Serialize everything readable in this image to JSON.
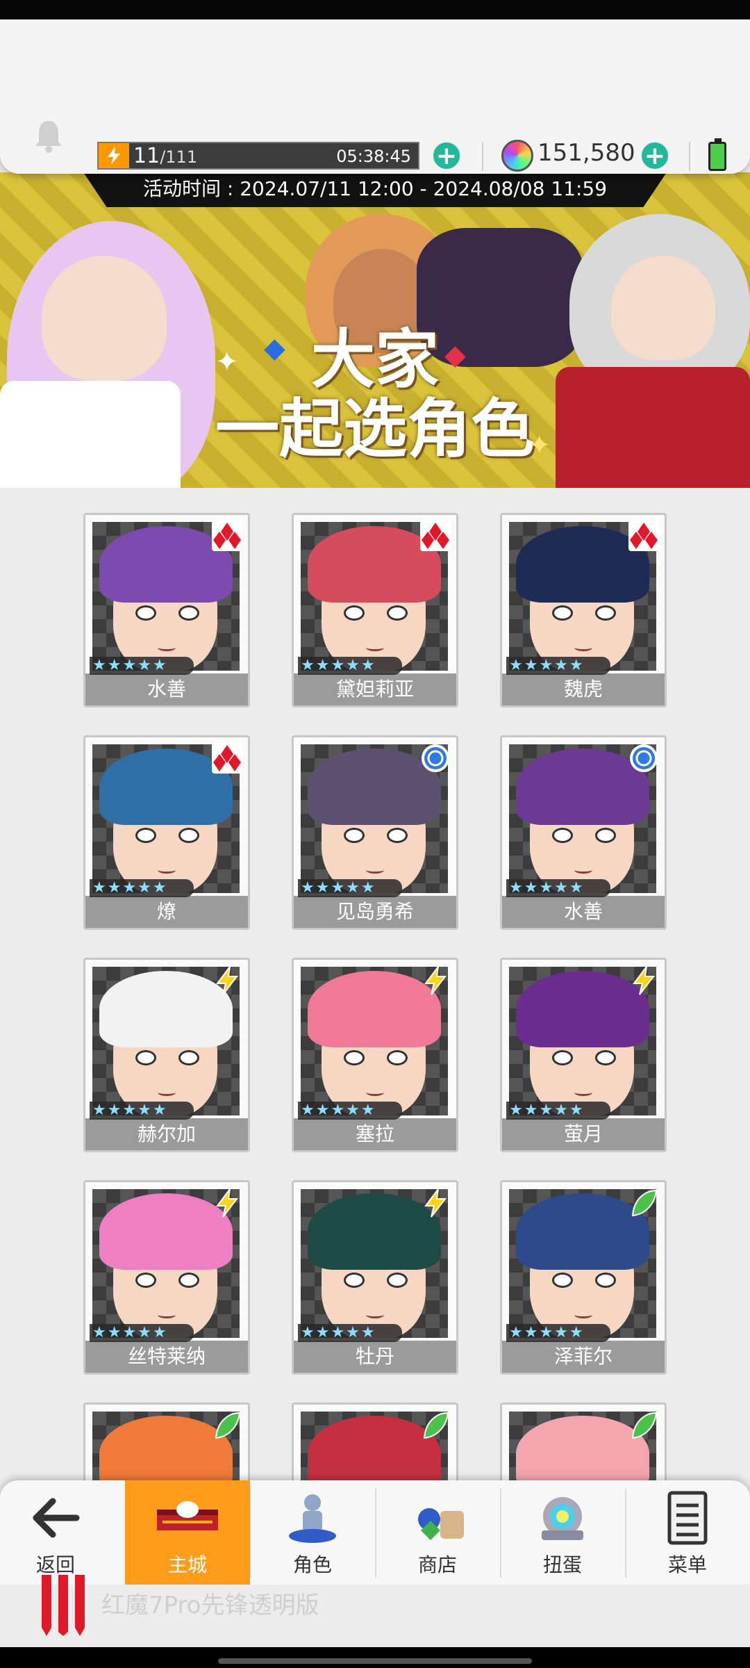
{
  "header": {
    "energy_current": "11",
    "energy_max": "/111",
    "energy_timer": "05:38:45",
    "energy_add": "+",
    "gems": "151,580",
    "gems_add": "+"
  },
  "banner": {
    "time": "活动时间 : 2024.07/11 12:00 - 2024.08/08 11:59",
    "title_line1": "大家",
    "title_line2": "一起选角色"
  },
  "characters": [
    {
      "name": "水善",
      "badge": "diamond",
      "stars": "★★★★★",
      "hair": "#7b4bb0"
    },
    {
      "name": "黛妲莉亚",
      "badge": "diamond",
      "stars": "★★★★★",
      "hair": "#d84a5e"
    },
    {
      "name": "魏虎",
      "badge": "diamond",
      "stars": "★★★★★",
      "hair": "#1f2a55"
    },
    {
      "name": "燎",
      "badge": "diamond",
      "stars": "★★★★★",
      "hair": "#2f6fa6"
    },
    {
      "name": "见岛勇希",
      "badge": "circle",
      "stars": "★★★★★",
      "hair": "#5c5170"
    },
    {
      "name": "水善",
      "badge": "circle",
      "stars": "★★★★★",
      "hair": "#6b3a93"
    },
    {
      "name": "赫尔加",
      "badge": "bolt",
      "stars": "★★★★★",
      "hair": "#f2f2f2"
    },
    {
      "name": "塞拉",
      "badge": "bolt",
      "stars": "★★★★★",
      "hair": "#f07a95"
    },
    {
      "name": "萤月",
      "badge": "bolt",
      "stars": "★★★★★",
      "hair": "#6a2e8f"
    },
    {
      "name": "丝特莱纳",
      "badge": "bolt",
      "stars": "★★★★★",
      "hair": "#ee7fc0"
    },
    {
      "name": "牡丹",
      "badge": "bolt",
      "stars": "★★★★★",
      "hair": "#1d4a44"
    },
    {
      "name": "泽菲尔",
      "badge": "leaf",
      "stars": "★★★★★",
      "hair": "#2d4a8a"
    },
    {
      "name": "",
      "badge": "leaf",
      "stars": "",
      "hair": "#f07a3a"
    },
    {
      "name": "",
      "badge": "leaf",
      "stars": "",
      "hair": "#c43040"
    },
    {
      "name": "",
      "badge": "leaf",
      "stars": "",
      "hair": "#f4a5b0"
    }
  ],
  "nav": {
    "back": "返回",
    "home": "主城",
    "characters": "角色",
    "shop": "商店",
    "gacha": "扭蛋",
    "menu": "菜单"
  },
  "watermark": "红魔7Pro先锋透明版",
  "colors": {
    "accent": "#ff9c1a",
    "plus": "#22b89a",
    "banner": "#d8c33a"
  }
}
